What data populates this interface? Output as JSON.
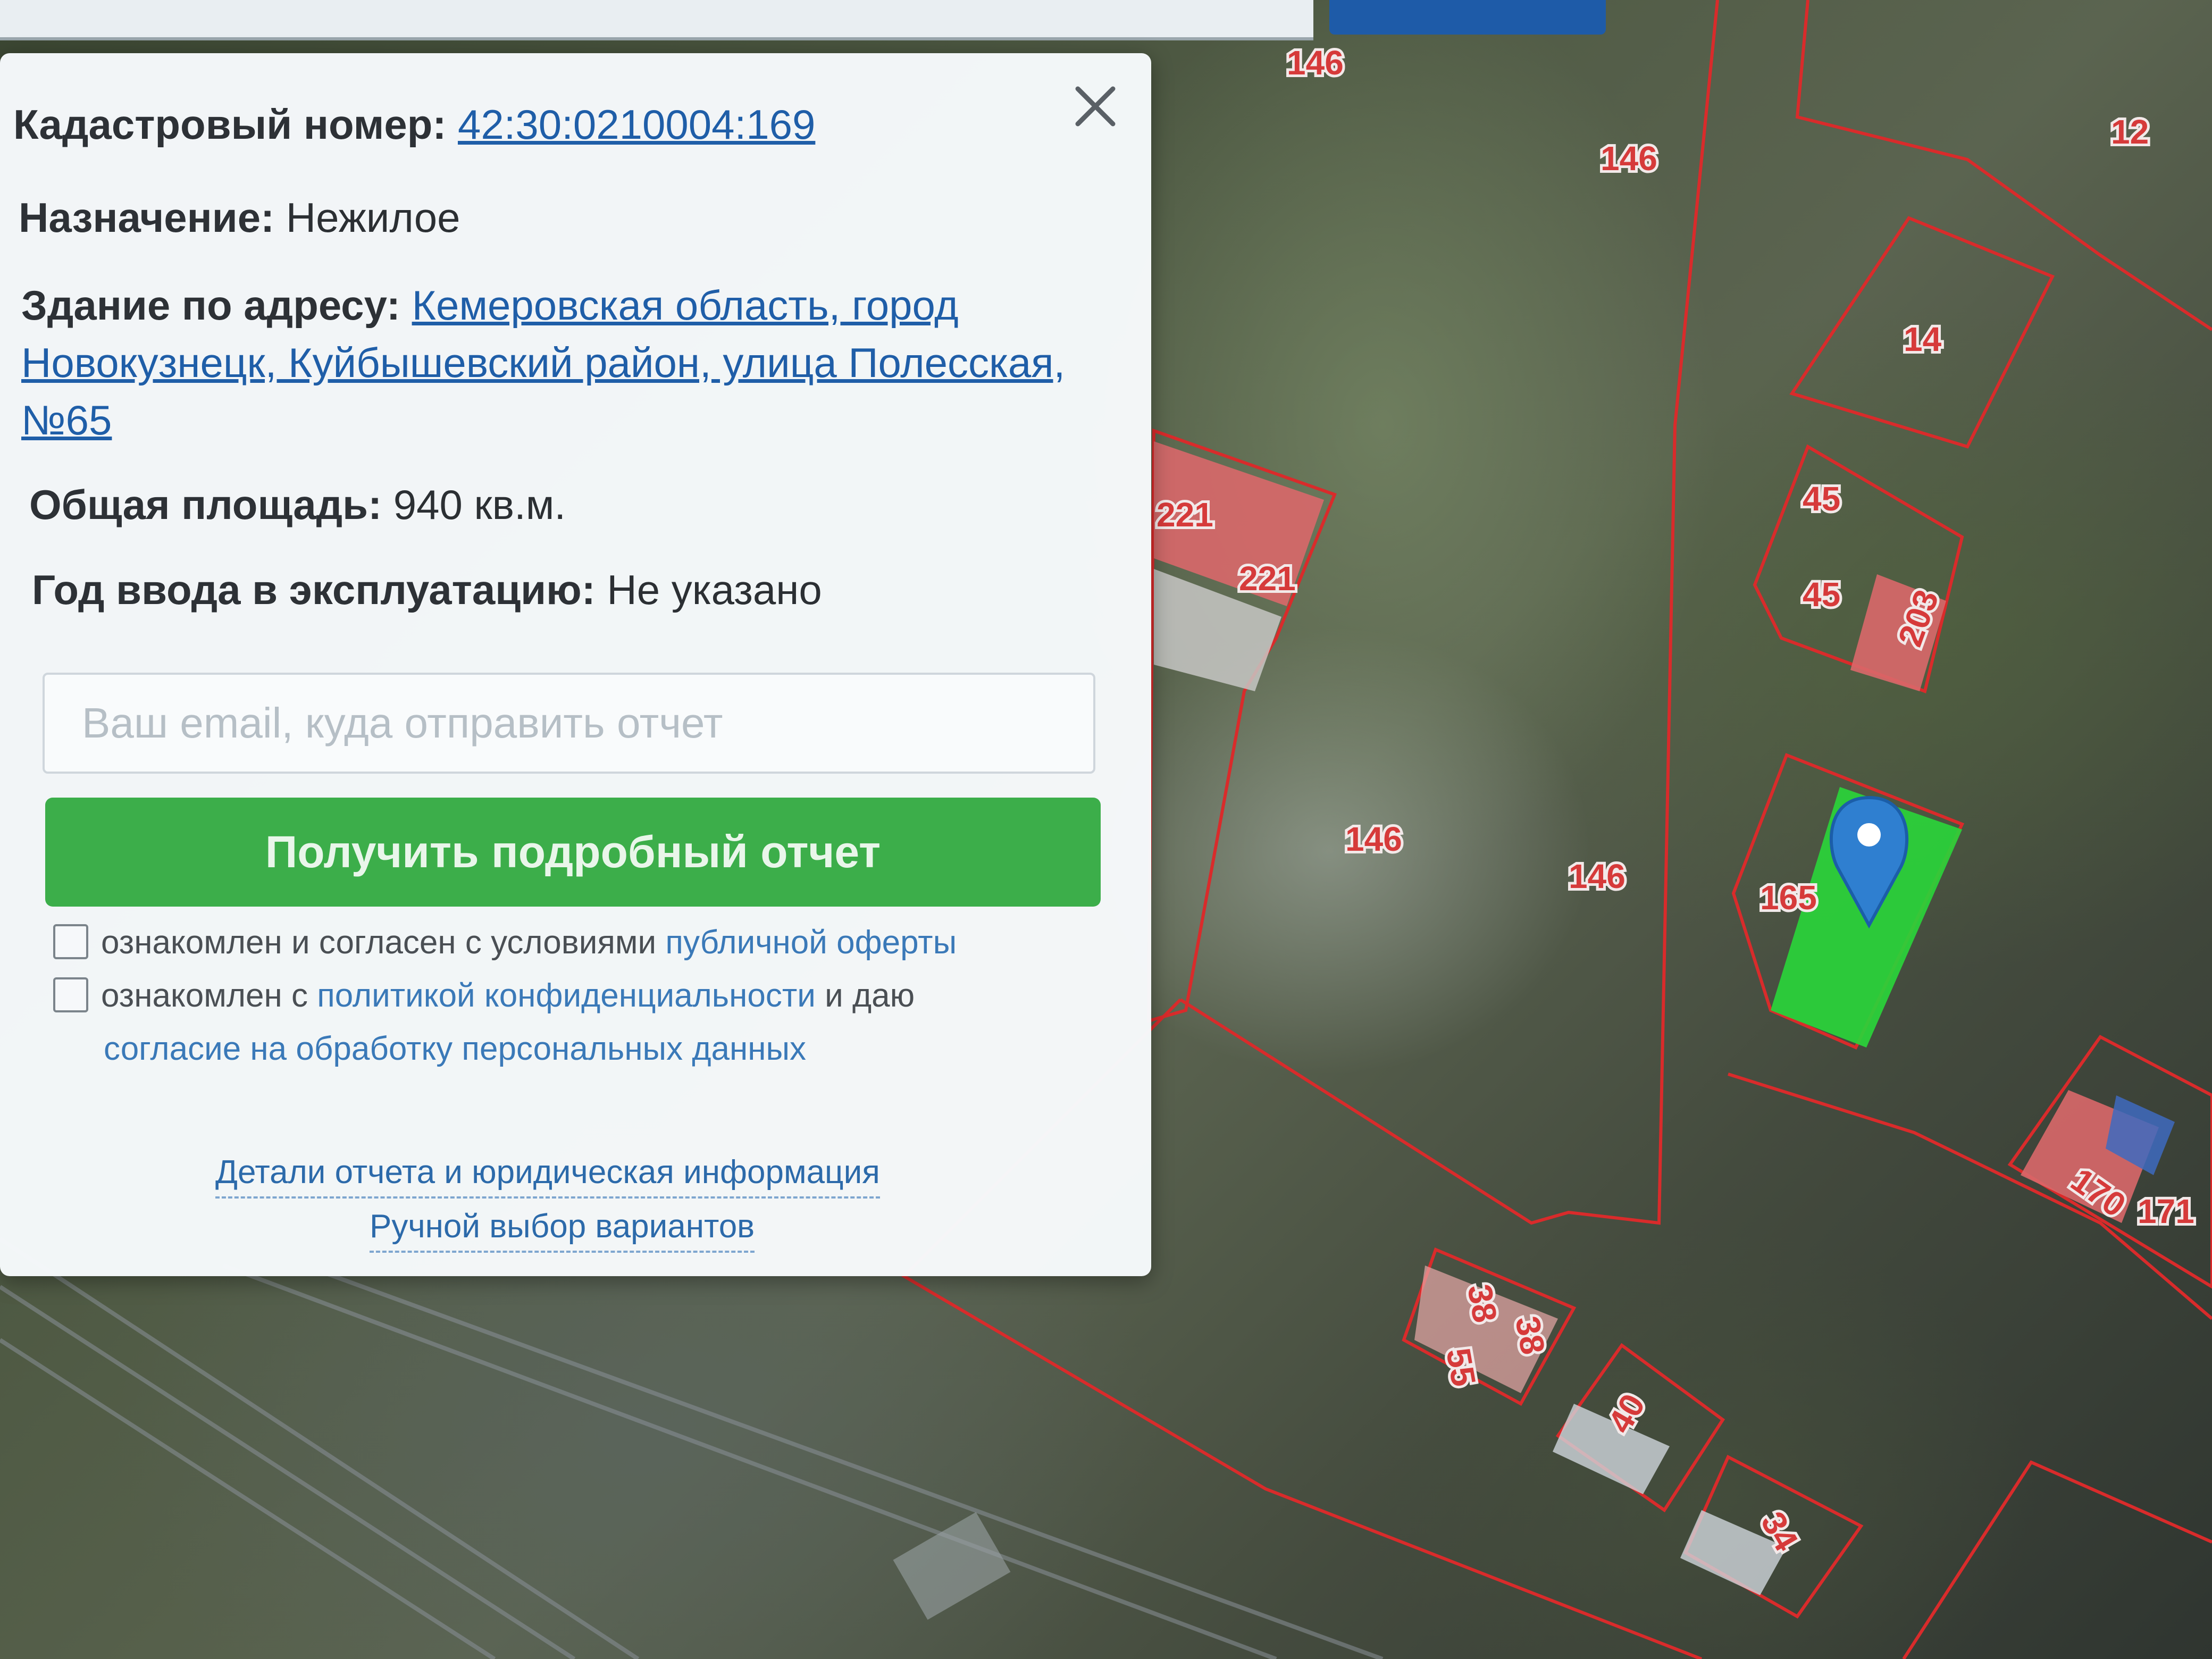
{
  "popup": {
    "cadastral_label": "Кадастровый номер:",
    "cadastral_number": "42:30:0210004:169",
    "purpose_label": "Назначение:",
    "purpose_value": "Нежилое",
    "address_label": "Здание по адресу:",
    "address_value": "Кемеровская область, город Новокузнецк, Куйбышевский район, улица Полесская, №65",
    "area_label": "Общая площадь:",
    "area_value": "940 кв.м.",
    "year_label": "Год ввода в эксплуатацию:",
    "year_value": "Не указано",
    "email_placeholder": "Ваш email, куда отправить отчет",
    "report_button": "Получить подробный отчет",
    "offer_text": "ознакомлен и согласен с условиями",
    "offer_link": "публичной оферты",
    "privacy_text_1": "ознакомлен с",
    "privacy_link": "политикой конфиденциальности",
    "privacy_text_2": "и даю",
    "consent_link": "согласие на обработку персональных данных",
    "details_link": "Детали отчета и юридическая информация",
    "manual_link": "Ручной выбор вариантов"
  },
  "map": {
    "labels": {
      "l146a": "146",
      "l146b": "146",
      "l146c": "146",
      "l146d": "146",
      "l12": "12",
      "l14": "14",
      "l45a": "45",
      "l45b": "45",
      "l203": "203",
      "l221a": "221",
      "l221b": "221",
      "l165": "165",
      "l170": "170",
      "l171": "171",
      "l38a": "38",
      "l38b": "38",
      "l55": "55",
      "l40": "40",
      "l34": "34"
    },
    "parcel_outline_color": "#d92b2b",
    "selected_parcel_color": "#2ad43a",
    "marker_color": "#2f7fd0",
    "building_roof_color": "#d9686a"
  },
  "theme": {
    "button_green": "#3cae4a",
    "link_blue": "#1f5ea8"
  },
  "icons": {
    "close": "close-icon",
    "marker": "map-marker-icon"
  }
}
